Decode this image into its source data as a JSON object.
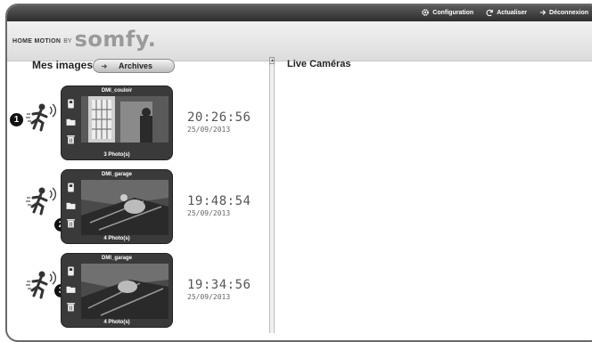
{
  "topnav": {
    "configuration": "Configuration",
    "actualiser": "Actualiser",
    "deconnexion": "Déconnexion"
  },
  "brand": {
    "product": "HOME MOTION",
    "by": "BY",
    "logo": "somfy."
  },
  "left": {
    "title": "Mes images",
    "archives": "Archives"
  },
  "right": {
    "title": "Live Caméras"
  },
  "events": [
    {
      "badge": "1",
      "camera": "DMI_couloir",
      "photos": "3 Photo(s)",
      "time": "20:26:56",
      "date": "25/09/2013"
    },
    {
      "badge": "2",
      "camera": "DMI_garage",
      "photos": "4 Photo(s)",
      "time": "19:48:54",
      "date": "25/09/2013"
    },
    {
      "badge": "3",
      "camera": "DMI_garage",
      "photos": "4 Photo(s)",
      "time": "19:34:56",
      "date": "25/09/2013"
    }
  ]
}
